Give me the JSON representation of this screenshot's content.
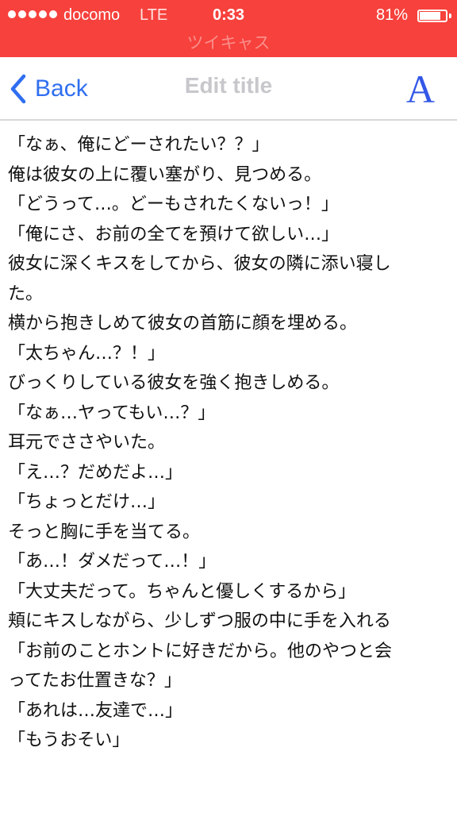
{
  "status_bar": {
    "carrier": "docomo",
    "network": "LTE",
    "time": "0:33",
    "battery_percent": "81%",
    "battery_level": 0.81,
    "signal_bars": 5
  },
  "app": {
    "name": "ツイキャス",
    "accent_color": "#f7413c"
  },
  "nav": {
    "back_label": "Back",
    "title": "Edit title",
    "font_button": "A",
    "link_color": "#2f6ef0"
  },
  "content": {
    "lines": [
      "「なぁ、俺にどーされたい？？」",
      "俺は彼女の上に覆い塞がり、見つめる。",
      "「どうって…。どーもされたくないっ！」",
      "「俺にさ、お前の全てを預けて欲しい…」",
      "彼女に深くキスをしてから、彼女の隣に添い寝し",
      "た。",
      "横から抱きしめて彼女の首筋に顔を埋める。",
      "「太ちゃん…？！」",
      "びっくりしている彼女を強く抱きしめる。",
      "「なぁ…ヤってもい…？」",
      "耳元でささやいた。",
      "「え…？だめだよ…」",
      "「ちょっとだけ…」",
      "そっと胸に手を当てる。",
      "「あ…！ダメだって…！」",
      "「大丈夫だって。ちゃんと優しくするから」",
      "頬にキスしながら、少しずつ服の中に手を入れる",
      "「お前のことホントに好きだから。他のやつと会",
      "ってたお仕置きな？」",
      "「あれは…友達で…」",
      "「もうおそい」"
    ]
  }
}
